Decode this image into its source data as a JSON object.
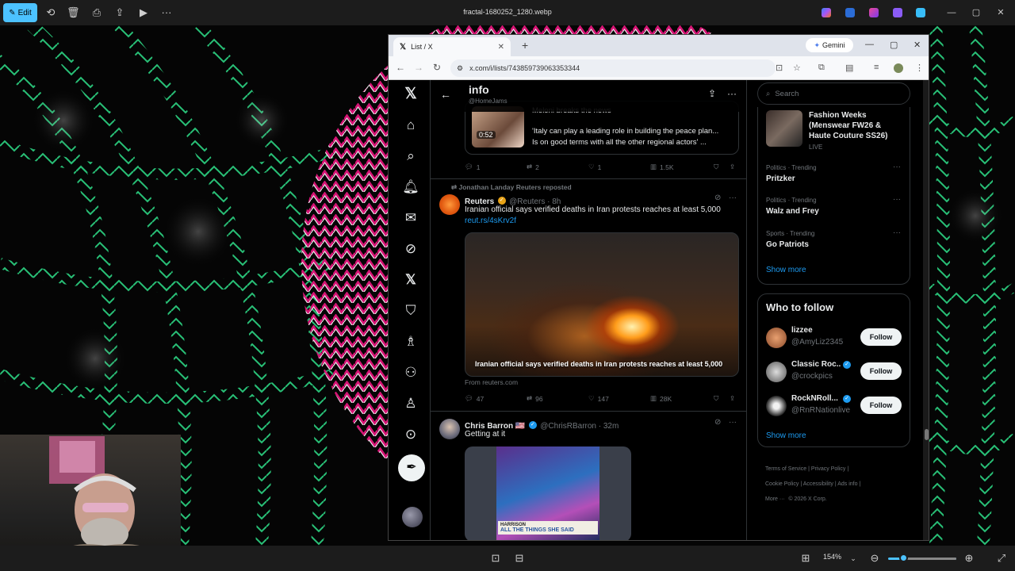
{
  "photos": {
    "edit_label": "Edit",
    "file_title": "fractal-1680252_1280.webp",
    "zoom_level": "154%"
  },
  "browser": {
    "tab_title": "List / X",
    "gemini_label": "Gemini",
    "url": "x.com/i/lists/743859739063353344"
  },
  "list_header": {
    "title": "info",
    "handle": "@HomeJams"
  },
  "tweet1": {
    "quote_lines": [
      "Meloni breaks the news",
      "'Italy can play a leading role in building the peace plan...",
      "Is on good terms with all the other regional actors' ..."
    ],
    "video_duration": "0:52",
    "replies": "1",
    "reposts": "2",
    "likes": "1",
    "views": "1.5K"
  },
  "tweet2": {
    "repost_by": "Jonathan Landay Reuters reposted",
    "name": "Reuters",
    "handle_time": "@Reuters · 8h",
    "text": "Iranian official says verified deaths in Iran protests reaches at least 5,000",
    "link": "reut.rs/4sKrv2f",
    "media_caption": "Iranian official says verified deaths in Iran protests reaches at least 5,000",
    "from": "From reuters.com",
    "replies": "47",
    "reposts": "96",
    "likes": "147",
    "views": "28K"
  },
  "tweet3": {
    "name": "Chris Barron 🇺🇸",
    "handle_time": "@ChrisRBarron · 32m",
    "text": "Getting at it",
    "album_artist": "HARRISON",
    "album_title": "ALL THE THINGS SHE SAID"
  },
  "sidebar": {
    "search_placeholder": "Search",
    "event": {
      "title": "Fashion Weeks (Menswear FW26 & Haute Couture SS26)",
      "status": "LIVE"
    },
    "trends": [
      {
        "meta": "Politics · Trending",
        "name": "Pritzker"
      },
      {
        "meta": "Politics · Trending",
        "name": "Walz and Frey"
      },
      {
        "meta": "Sports · Trending",
        "name": "Go Patriots"
      }
    ],
    "show_more": "Show more",
    "who_to_follow_title": "Who to follow",
    "follow_label": "Follow",
    "suggestions": [
      {
        "name": "lizzee",
        "handle": "@AmyLiz2345"
      },
      {
        "name": "Classic Roc...",
        "handle": "@crockpics"
      },
      {
        "name": "RockNRoll...",
        "handle": "@RnRNationlive"
      }
    ],
    "show_more_2": "Show more",
    "footer": [
      "Terms of Service",
      "Privacy Policy",
      "Cookie Policy",
      "Accessibility",
      "Ads info",
      "More ···",
      "© 2026 X Corp."
    ]
  },
  "colors": {
    "x_background": "#000000",
    "link_blue": "#1d9bf0",
    "windows_accent": "#4cc2ff",
    "fractal_green": "#2fe08a",
    "fractal_pink": "#e0157a"
  }
}
